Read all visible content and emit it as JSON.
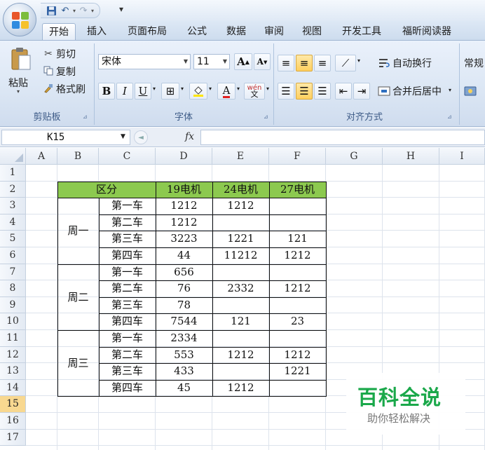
{
  "qat": {
    "more_glyph": "▾"
  },
  "tabs": [
    {
      "label": "开始",
      "active": true
    },
    {
      "label": "插入"
    },
    {
      "label": "页面布局"
    },
    {
      "label": "公式"
    },
    {
      "label": "数据"
    },
    {
      "label": "审阅"
    },
    {
      "label": "视图"
    },
    {
      "label": "开发工具"
    },
    {
      "label": "福昕阅读器"
    }
  ],
  "ribbon": {
    "clipboard": {
      "label": "剪贴板",
      "paste": "粘贴",
      "cut": "剪切",
      "copy": "复制",
      "format_painter": "格式刷"
    },
    "font": {
      "label": "字体",
      "font_name": "宋体",
      "font_size": "11",
      "bold": "B",
      "italic": "I",
      "underline": "U",
      "grow": "A",
      "shrink": "A",
      "font_color_letter": "A",
      "phonetic": "wén"
    },
    "alignment": {
      "label": "对齐方式",
      "wrap_text": "自动换行",
      "merge_center": "合并后居中"
    },
    "number": {
      "format": "常规"
    },
    "colors": {
      "ribbon_bg": "#dbe6f4",
      "highlight": "#ffcf5e",
      "font_color": "#e02020",
      "fill_color": "#ffe600"
    }
  },
  "formula_bar": {
    "cell_ref": "K15",
    "fx": "fx",
    "value": ""
  },
  "columns": [
    "A",
    "B",
    "C",
    "D",
    "E",
    "F",
    "G",
    "H",
    "I"
  ],
  "rows": [
    "1",
    "2",
    "3",
    "4",
    "5",
    "6",
    "7",
    "8",
    "9",
    "10",
    "11",
    "12",
    "13",
    "14",
    "15",
    "16",
    "17"
  ],
  "active_row": "15",
  "table": {
    "header": {
      "category": "区分",
      "col1": "19电机",
      "col2": "24电机",
      "col3": "27电机"
    },
    "header_color": "#8cc94f",
    "groups": [
      {
        "name": "周一",
        "rows": [
          {
            "car": "第一车",
            "v19": "1212",
            "v24": "1212",
            "v27": ""
          },
          {
            "car": "第二车",
            "v19": "1212",
            "v24": "",
            "v27": ""
          },
          {
            "car": "第三车",
            "v19": "3223",
            "v24": "1221",
            "v27": "121"
          },
          {
            "car": "第四车",
            "v19": "44",
            "v24": "11212",
            "v27": "1212"
          }
        ]
      },
      {
        "name": "周二",
        "rows": [
          {
            "car": "第一车",
            "v19": "656",
            "v24": "",
            "v27": ""
          },
          {
            "car": "第二车",
            "v19": "76",
            "v24": "2332",
            "v27": "1212"
          },
          {
            "car": "第三车",
            "v19": "78",
            "v24": "",
            "v27": ""
          },
          {
            "car": "第四车",
            "v19": "7544",
            "v24": "121",
            "v27": "23"
          }
        ]
      },
      {
        "name": "周三",
        "rows": [
          {
            "car": "第一车",
            "v19": "2334",
            "v24": "",
            "v27": ""
          },
          {
            "car": "第二车",
            "v19": "553",
            "v24": "1212",
            "v27": "1212"
          },
          {
            "car": "第三车",
            "v19": "433",
            "v24": "",
            "v27": "1221"
          },
          {
            "car": "第四车",
            "v19": "45",
            "v24": "1212",
            "v27": ""
          }
        ]
      }
    ]
  },
  "watermark": {
    "title": "百科全说",
    "subtitle": "助你轻松解决",
    "color": "#1aa84a"
  }
}
